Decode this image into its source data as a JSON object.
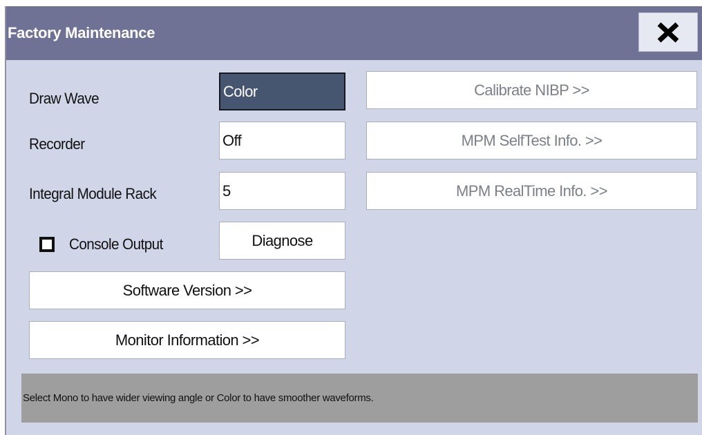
{
  "window": {
    "title": "Factory Maintenance",
    "close_icon": "close-icon"
  },
  "settings": {
    "draw_wave": {
      "label": "Draw Wave",
      "value": "Color"
    },
    "recorder": {
      "label": "Recorder",
      "value": "Off"
    },
    "integral_module_rack": {
      "label": "Integral Module Rack",
      "value": "5"
    },
    "console_output": {
      "label": "Console Output",
      "checked": false
    },
    "diagnose_label": "Diagnose"
  },
  "buttons": {
    "software_version": "Software Version >>",
    "monitor_information": "Monitor Information >>",
    "calibrate_nibp": "Calibrate NIBP >>",
    "mpm_selftest_info": "MPM SelfTest Info. >>",
    "mpm_realtime_info": "MPM RealTime Info. >>"
  },
  "status": {
    "help_text": "Select Mono to have wider viewing angle or Color to have smoother waveforms."
  },
  "colors": {
    "title_bar": "#6f7294",
    "dialog_background": "#d0d6e8",
    "selected_field": "#465670",
    "status_bar": "#9e9e9e",
    "disabled_text": "#7c7f89"
  }
}
